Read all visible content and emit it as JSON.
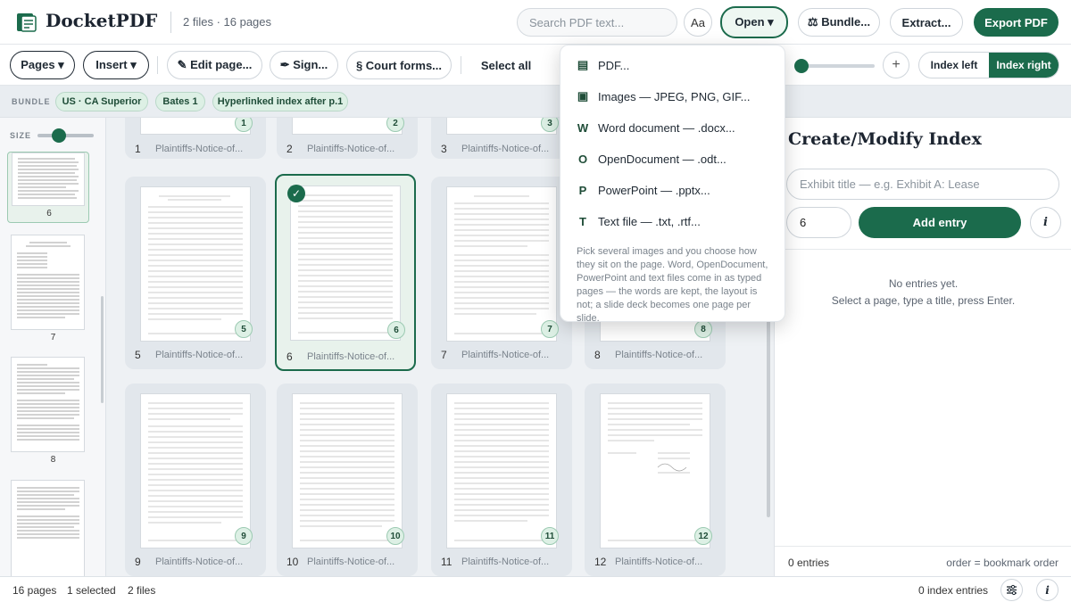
{
  "header": {
    "app_name": "DocketPDF",
    "file_info": "2 files · 16 pages",
    "search_placeholder": "Search PDF text...",
    "aa_label": "Aa",
    "open_label": "Open ▾",
    "bundle_label": "⚖ Bundle...",
    "extract_label": "Extract...",
    "export_label": "Export PDF"
  },
  "toolbar": {
    "pages": "Pages ▾",
    "insert": "Insert ▾",
    "edit_page": "✎ Edit page...",
    "sign": "✒ Sign...",
    "court_forms": "§ Court forms...",
    "select_all": "Select all",
    "zoom_plus": "+",
    "index_left": "Index left",
    "index_right": "Index right"
  },
  "bundle": {
    "label": "BUNDLE",
    "chips": [
      "US · CA Superior",
      "Bates 1",
      "Hyperlinked index after p.1"
    ]
  },
  "sidebar": {
    "size_label": "SIZE",
    "thumbs": [
      {
        "label": "6"
      },
      {
        "label": "7"
      },
      {
        "label": "8"
      }
    ]
  },
  "grid": {
    "cards": [
      {
        "num": "1",
        "name": "Plaintiffs-Notice-of...",
        "badge": "1"
      },
      {
        "num": "2",
        "name": "Plaintiffs-Notice-of...",
        "badge": "2"
      },
      {
        "num": "3",
        "name": "Plaintiffs-Notice-of...",
        "badge": "3"
      },
      {
        "num": "5",
        "name": "Plaintiffs-Notice-of...",
        "badge": "5"
      },
      {
        "num": "6",
        "name": "Plaintiffs-Notice-of...",
        "badge": "6",
        "check": "✓"
      },
      {
        "num": "7",
        "name": "Plaintiffs-Notice-of...",
        "badge": "7"
      },
      {
        "num": "8",
        "name": "Plaintiffs-Notice-of...",
        "badge": "8"
      },
      {
        "num": "9",
        "name": "Plaintiffs-Notice-of...",
        "badge": "9"
      },
      {
        "num": "10",
        "name": "Plaintiffs-Notice-of...",
        "badge": "10"
      },
      {
        "num": "11",
        "name": "Plaintiffs-Notice-of...",
        "badge": "11"
      },
      {
        "num": "12",
        "name": "Plaintiffs-Notice-of...",
        "badge": "12"
      }
    ]
  },
  "index_panel": {
    "title": "Create/Modify Index",
    "exhibit_placeholder": "Exhibit title — e.g. Exhibit A: Lease",
    "page_value": "6",
    "add_entry": "Add entry",
    "info": "i",
    "empty_title": "No entries yet.",
    "empty_hint": "Select a page, type a title, press Enter.",
    "entries_count": "0 entries",
    "order_note": "order = bookmark order"
  },
  "status": {
    "pages": "16 pages",
    "selected": "1 selected",
    "files": "2 files",
    "index_entries": "0 index entries",
    "info": "i"
  },
  "open_menu": {
    "items": [
      {
        "icon": "▤",
        "label": "PDF..."
      },
      {
        "icon": "▣",
        "label": "Images — JPEG, PNG, GIF..."
      },
      {
        "icon": "W",
        "label": "Word document — .docx..."
      },
      {
        "icon": "O",
        "label": "OpenDocument — .odt..."
      },
      {
        "icon": "P",
        "label": "PowerPoint — .pptx..."
      },
      {
        "icon": "T",
        "label": "Text file — .txt, .rtf..."
      }
    ],
    "help": "Pick several images and you choose how they sit on the page. Word, OpenDocument, PowerPoint and text files come in as typed pages — the words are kept, the layout is not; a slide deck becomes one page per slide."
  },
  "colors": {
    "accent": "#1b6b4c",
    "chip_bg": "#ddf0e5"
  }
}
